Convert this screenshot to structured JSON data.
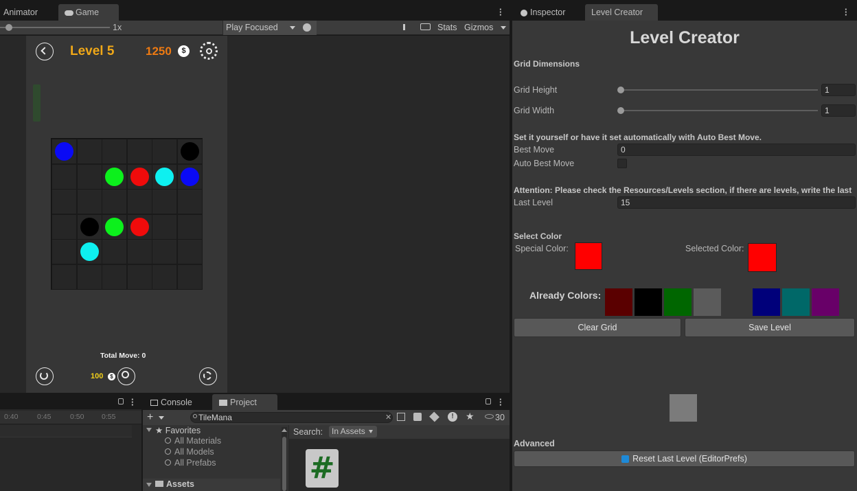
{
  "top_tabs": {
    "animator": "Animator",
    "game": "Game",
    "inspector": "Inspector",
    "level_creator": "Level Creator"
  },
  "game_toolbar": {
    "scale_value": "1x",
    "play_mode": "Play Focused",
    "stats": "Stats",
    "gizmos": "Gizmos"
  },
  "game": {
    "level_title": "Level 5",
    "coins": "1250",
    "total_move": "Total Move: 0",
    "hint_cost": "100"
  },
  "grid": {
    "rows": 6,
    "cols": 6,
    "balls": [
      {
        "row": 0,
        "col": 0,
        "color": "#0a0af5"
      },
      {
        "row": 0,
        "col": 5,
        "color": "#000000"
      },
      {
        "row": 1,
        "col": 2,
        "color": "#0cf01c"
      },
      {
        "row": 1,
        "col": 3,
        "color": "#f00b0b"
      },
      {
        "row": 1,
        "col": 4,
        "color": "#0ef0f0"
      },
      {
        "row": 1,
        "col": 5,
        "color": "#0a0af5"
      },
      {
        "row": 3,
        "col": 1,
        "color": "#000000"
      },
      {
        "row": 3,
        "col": 2,
        "color": "#0cf01c"
      },
      {
        "row": 3,
        "col": 3,
        "color": "#f00b0b"
      },
      {
        "row": 4,
        "col": 1,
        "color": "#0ef0f0"
      }
    ]
  },
  "bottom_panel": {
    "console_tab": "Console",
    "project_tab": "Project",
    "timeline_ticks": [
      "0:40",
      "0:45",
      "0:50",
      "0:55"
    ],
    "search_value": "TileMana",
    "search_label": "Search:",
    "search_scope": "In Assets",
    "hidden_count": "30",
    "favorites": "Favorites",
    "fav_items": [
      "All Materials",
      "All Models",
      "All Prefabs"
    ],
    "assets": "Assets"
  },
  "level_creator": {
    "title": "Level Creator",
    "grid_dimensions": "Grid Dimensions",
    "grid_height_label": "Grid Height",
    "grid_height_value": "1",
    "grid_width_label": "Grid Width",
    "grid_width_value": "1",
    "best_move_hint": "Set it yourself or have it set automatically with Auto Best Move.",
    "best_move_label": "Best Move",
    "best_move_value": "0",
    "auto_best_move_label": "Auto Best Move",
    "attention": "Attention: Please check the Resources/Levels section, if there are levels, write the last",
    "last_level_label": "Last Level",
    "last_level_value": "15",
    "select_color": "Select Color",
    "special_color_label": "Special Color:",
    "special_color": "#ff0000",
    "selected_color_label": "Selected Color:",
    "selected_color": "#ff0000",
    "already_colors_label": "Already Colors:",
    "already_colors": [
      "#5a0000",
      "#000000",
      "#006600",
      "#5b5b5b",
      "#383838",
      "#00007a",
      "#006868",
      "#680068"
    ],
    "clear_grid": "Clear Grid",
    "save_level": "Save Level",
    "advanced": "Advanced",
    "reset_last_level": "Reset Last Level (EditorPrefs)"
  }
}
